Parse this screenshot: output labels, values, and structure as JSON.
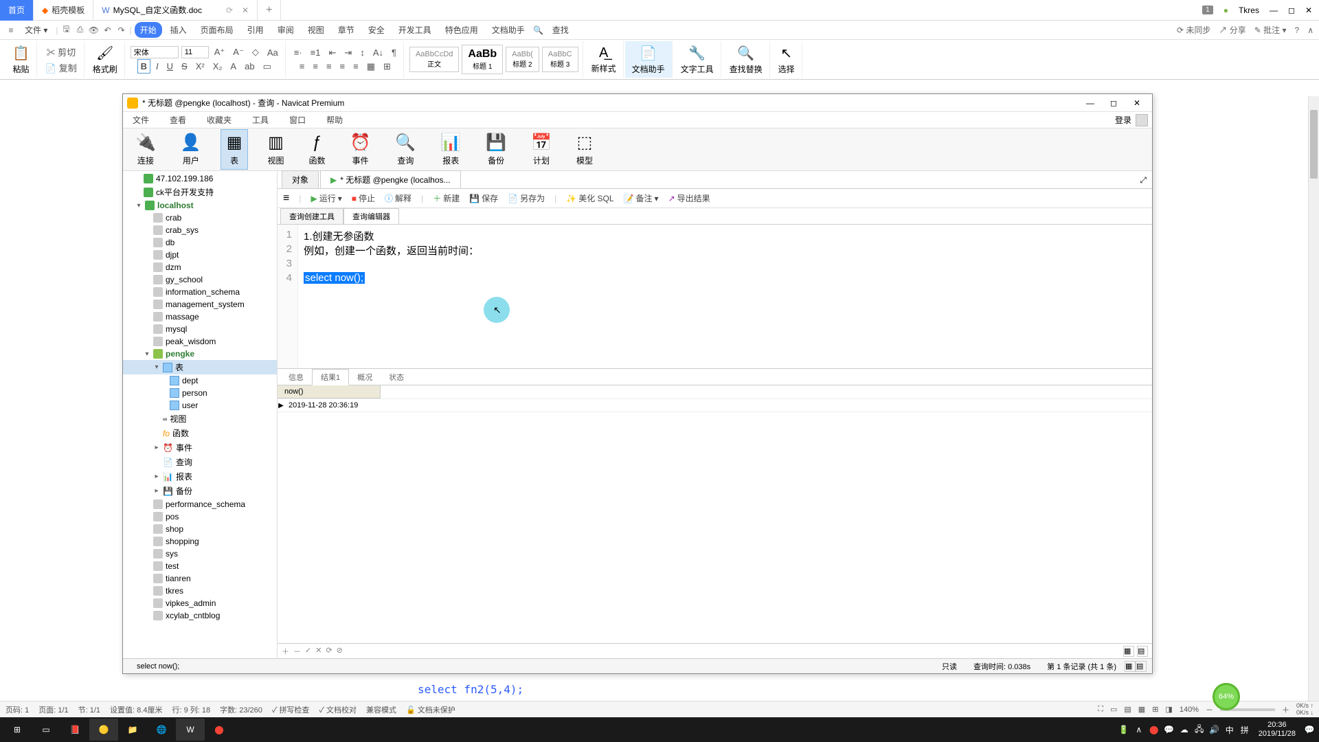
{
  "wps": {
    "tabs": {
      "home": "首页",
      "template": "稻壳模板",
      "doc": "MySQL_自定义函数.doc",
      "add": "+"
    },
    "titleRight": {
      "badge": "1",
      "user": "Tkres"
    },
    "fileMenu": "文件",
    "menu": [
      "开始",
      "插入",
      "页面布局",
      "引用",
      "审阅",
      "视图",
      "章节",
      "安全",
      "开发工具",
      "特色应用",
      "文档助手"
    ],
    "search": "查找",
    "menuRight": [
      "未同步",
      "分享",
      "批注"
    ],
    "toolbar": {
      "paste": "粘贴",
      "cut": "剪切",
      "copy": "复制",
      "formatPainter": "格式刷",
      "font": "宋体",
      "fontSize": "11",
      "styles": [
        {
          "preview": "AaBbCcDd",
          "label": "正文"
        },
        {
          "preview": "AaBb",
          "label": "标题 1"
        },
        {
          "preview": "AaBb(",
          "label": "标题 2"
        },
        {
          "preview": "AaBbC",
          "label": "标题 3"
        }
      ],
      "newStyle": "新样式",
      "docAssist": "文档助手",
      "textTool": "文字工具",
      "findReplace": "查找替换",
      "select": "选择"
    },
    "statusbar": {
      "items": [
        "页码: 1",
        "页面: 1/1",
        "节: 1/1",
        "设置值: 8.4厘米",
        "行: 9  列: 18",
        "字数: 23/260",
        "拼写检查",
        "文档校对",
        "兼容模式",
        "文档未保护"
      ],
      "zoom": "140%",
      "zoomBadge": "64%",
      "netUp": "0K/s",
      "netDown": "0K/s"
    },
    "docSnippet": "select fn2(5,4);"
  },
  "navicat": {
    "title": "* 无标题 @pengke (localhost) - 查询 - Navicat Premium",
    "menus": [
      "文件",
      "查看",
      "收藏夹",
      "工具",
      "窗口",
      "帮助"
    ],
    "login": "登录",
    "toolbar": [
      "连接",
      "用户",
      "表",
      "视图",
      "函数",
      "事件",
      "查询",
      "报表",
      "备份",
      "计划",
      "模型"
    ],
    "tree": {
      "servers": [
        "47.102.199.186",
        "ck平台开发支持"
      ],
      "localhost": "localhost",
      "dbs": [
        "crab",
        "crab_sys",
        "db",
        "djpt",
        "dzm",
        "gy_school",
        "information_schema",
        "management_system",
        "massage",
        "mysql",
        "peak_wisdom"
      ],
      "activeDb": "pengke",
      "tablesLabel": "表",
      "tables": [
        "dept",
        "person",
        "user"
      ],
      "folders": [
        "视图",
        "函数",
        "事件",
        "查询",
        "报表",
        "备份"
      ],
      "dbsAfter": [
        "performance_schema",
        "pos",
        "shop",
        "shopping",
        "sys",
        "test",
        "tianren",
        "tkres",
        "vipkes_admin",
        "xcylab_cntblog"
      ]
    },
    "tabs": {
      "objects": "对象",
      "query": "* 无标题 @pengke (localhos..."
    },
    "actions": {
      "run": "运行",
      "stop": "停止",
      "explain": "解释",
      "new": "新建",
      "save": "保存",
      "saveAs": "另存为",
      "beautify": "美化 SQL",
      "remark": "备注",
      "export": "导出结果"
    },
    "subtabs": [
      "查询创建工具",
      "查询编辑器"
    ],
    "sql": {
      "lines": [
        "1",
        "2",
        "3",
        "4"
      ],
      "line1": "1.创建无参函数",
      "line2": "例如，创建一个函数，返回当前时间：",
      "line4_sel": "select now();"
    },
    "resultTabs": [
      "信息",
      "结果1",
      "概况",
      "状态"
    ],
    "result": {
      "header": "now()",
      "value": "2019-11-28 20:36:19"
    },
    "footer": {
      "sql": "select now();"
    },
    "status": {
      "readonly": "只读",
      "queryTime": "查询时间: 0.038s",
      "records": "第 1 条记录 (共 1 条)"
    }
  },
  "taskbar": {
    "time": "20:36",
    "date": "2019/11/28",
    "ime": "拼",
    "lang": "中"
  }
}
